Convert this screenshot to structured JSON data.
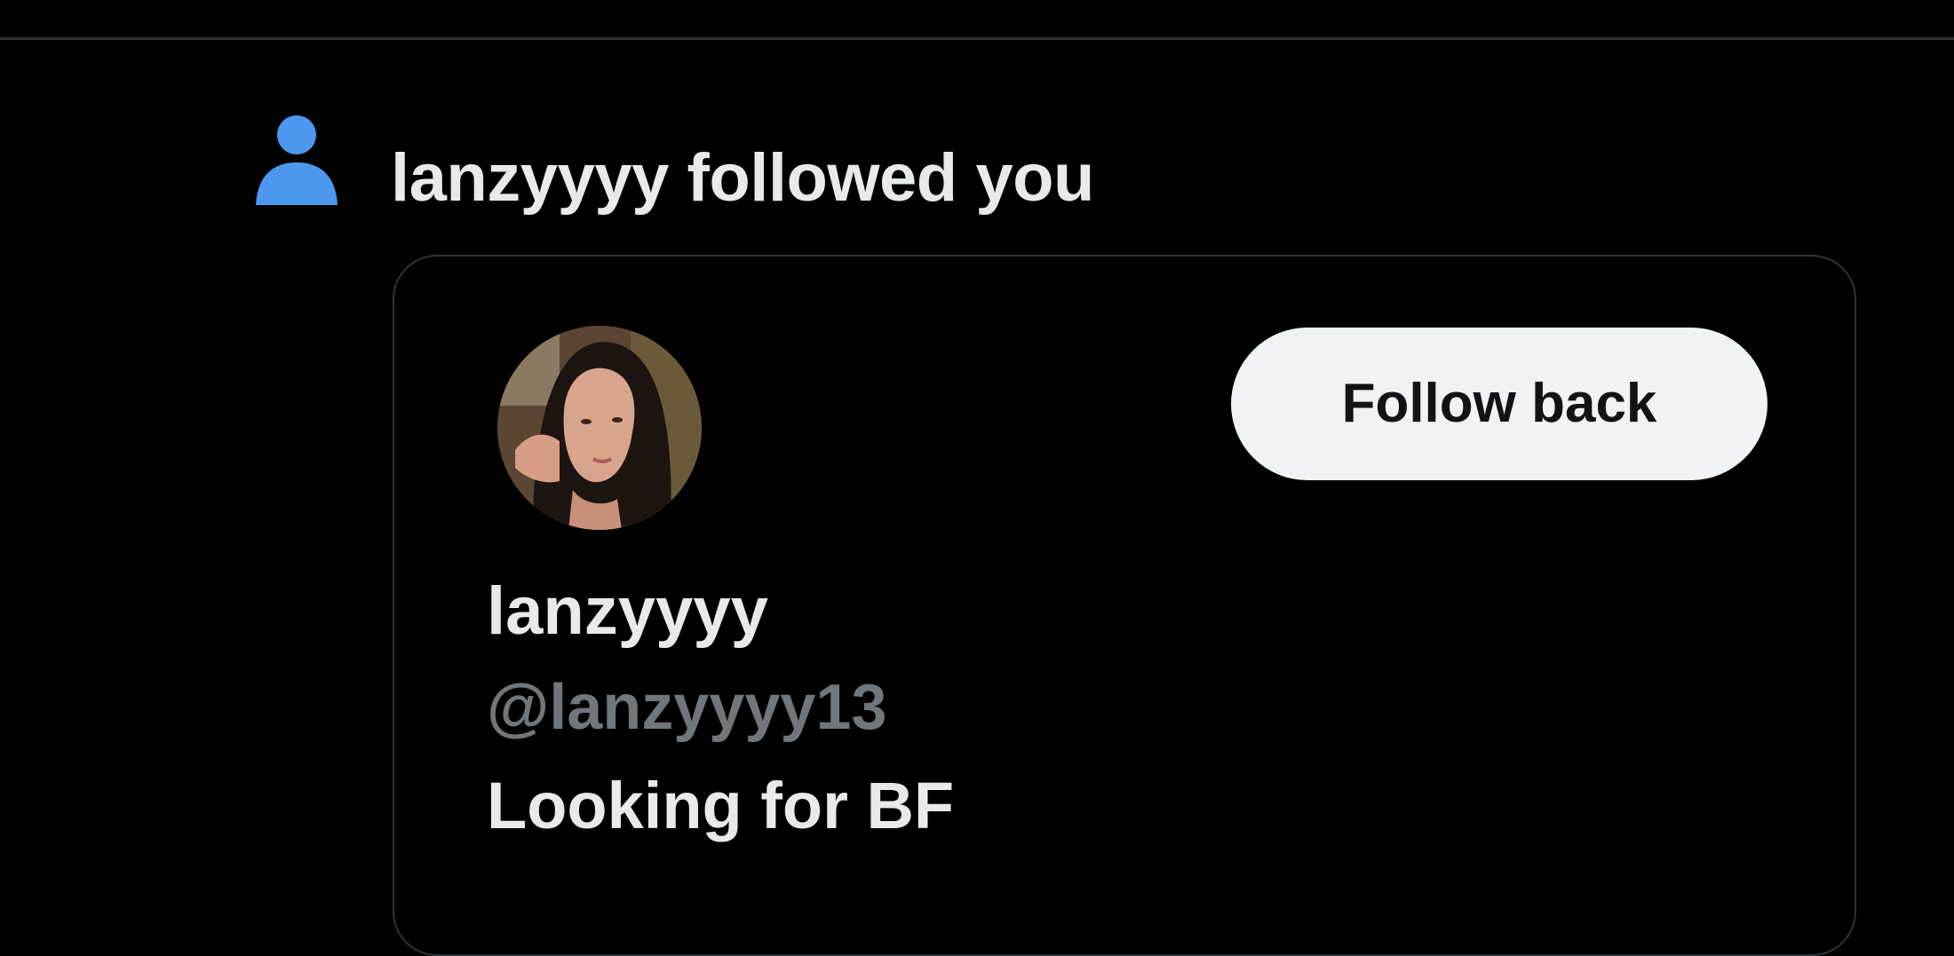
{
  "notification": {
    "icon": "person-icon",
    "icon_color": "#1d9bf0",
    "actor_name": "lanzyyyy",
    "action_text": " followed you"
  },
  "user_card": {
    "display_name": "lanzyyyy",
    "handle": "@lanzyyyy13",
    "bio": "Looking for BF",
    "follow_back_label": "Follow back",
    "avatar": "profile-photo"
  },
  "colors": {
    "background": "#000000",
    "text_primary": "#e7e9ea",
    "text_secondary": "#71767b",
    "border": "#2f3336",
    "button_bg": "#eff3f4",
    "button_text": "#0f1419",
    "accent": "#1d9bf0"
  }
}
